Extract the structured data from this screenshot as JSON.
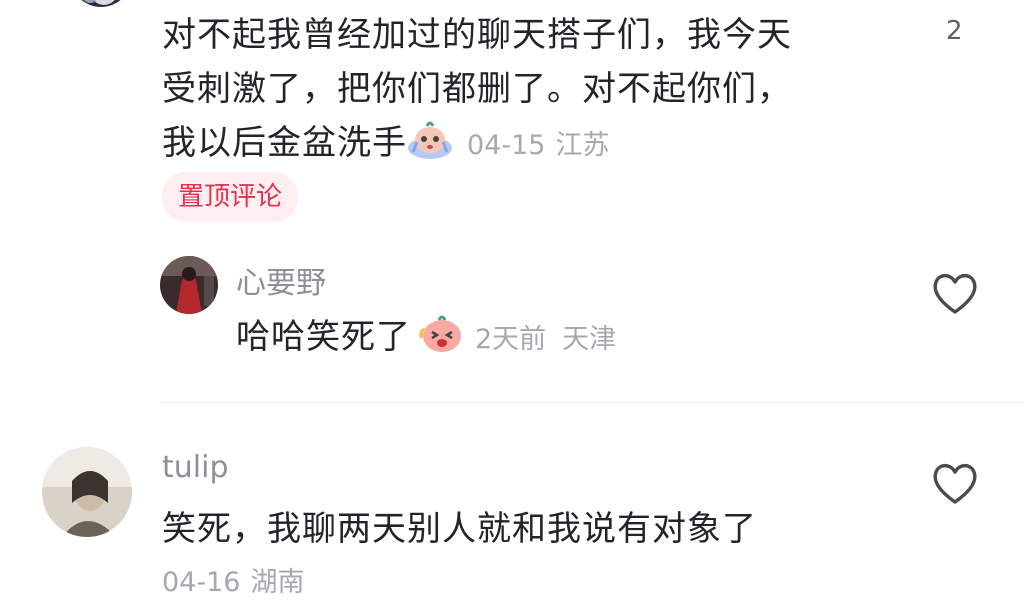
{
  "comments": [
    {
      "text_line1": "对不起我曾经加过的聊天搭子们，我今天",
      "text_line2": "受刺激了，把你们都删了。对不起你们，",
      "text_line3": "我以后金盆洗手",
      "emoji_icon": "crying-face-emoji-icon",
      "date": "04-15",
      "location": "江苏",
      "like_count": "2",
      "badge": "置顶评论"
    },
    {
      "username": "心要野",
      "text": "哈哈笑死了",
      "emoji_icon": "laughing-face-emoji-icon",
      "date": "2天前",
      "location": "天津",
      "like_icon": "heart-outline-icon"
    },
    {
      "username": "tulip",
      "text": "笑死，我聊两天别人就和我说有对象了",
      "date": "04-16",
      "location": "湖南",
      "like_icon": "heart-outline-icon"
    }
  ]
}
